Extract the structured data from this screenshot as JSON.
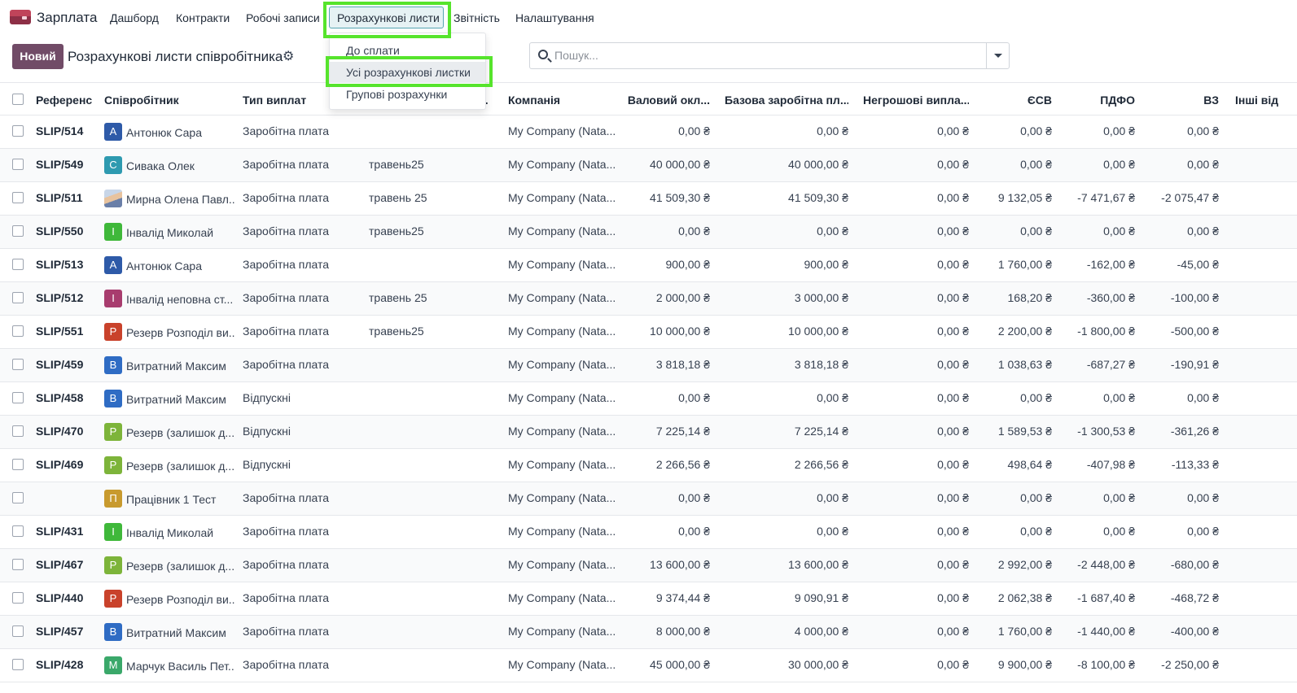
{
  "app": {
    "name": "Зарплата"
  },
  "nav": {
    "items": [
      "Дашборд",
      "Контракти",
      "Робочі записи",
      "Розрахункові листи",
      "Звітність",
      "Налаштування"
    ]
  },
  "dropdown": {
    "items": [
      "До сплати",
      "Усі розрахункові листки",
      "Групові розрахунки"
    ],
    "active_index": 1
  },
  "control_panel": {
    "new_button": "Новий",
    "title": "Розрахункові листи співробітника",
    "search_placeholder": "Пошук..."
  },
  "columns": [
    "Референс",
    "Співробітник",
    "Тип виплат",
    "...",
    "Компанія",
    "Валовий окл...",
    "Базова заробітна пл...",
    "Негрошові випла...",
    "ЄСВ",
    "ПДФО",
    "ВЗ",
    "Інші від"
  ],
  "rows": [
    {
      "ref": "SLIP/514",
      "initial": "А",
      "color": "#2e5aa8",
      "employee": "Антонюк Сара",
      "type": "Заробітна плата",
      "batch": "",
      "company": "My Company (Nata...",
      "gross": "0,00 ₴",
      "basic": "0,00 ₴",
      "noncash": "0,00 ₴",
      "esv": "0,00 ₴",
      "pdfo": "0,00 ₴",
      "vz": "0,00 ₴"
    },
    {
      "ref": "SLIP/549",
      "initial": "С",
      "color": "#2e9ab0",
      "employee": "Сивака Олек",
      "type": "Заробітна плата",
      "batch": "травень25",
      "company": "My Company (Nata...",
      "gross": "40 000,00 ₴",
      "basic": "40 000,00 ₴",
      "noncash": "0,00 ₴",
      "esv": "0,00 ₴",
      "pdfo": "0,00 ₴",
      "vz": "0,00 ₴"
    },
    {
      "ref": "SLIP/511",
      "initial": "",
      "color": "photo",
      "employee": "Мирна Олена Павл...",
      "type": "Заробітна плата",
      "batch": "травень 25",
      "company": "My Company (Nata...",
      "gross": "41 509,30 ₴",
      "basic": "41 509,30 ₴",
      "noncash": "0,00 ₴",
      "esv": "9 132,05 ₴",
      "pdfo": "-7 471,67 ₴",
      "vz": "-2 075,47 ₴"
    },
    {
      "ref": "SLIP/550",
      "initial": "І",
      "color": "#3fb83a",
      "employee": "Інвалід Миколай",
      "type": "Заробітна плата",
      "batch": "травень25",
      "company": "My Company (Nata...",
      "gross": "0,00 ₴",
      "basic": "0,00 ₴",
      "noncash": "0,00 ₴",
      "esv": "0,00 ₴",
      "pdfo": "0,00 ₴",
      "vz": "0,00 ₴"
    },
    {
      "ref": "SLIP/513",
      "initial": "А",
      "color": "#2e5aa8",
      "employee": "Антонюк Сара",
      "type": "Заробітна плата",
      "batch": "",
      "company": "My Company (Nata...",
      "gross": "900,00 ₴",
      "basic": "900,00 ₴",
      "noncash": "0,00 ₴",
      "esv": "1 760,00 ₴",
      "pdfo": "-162,00 ₴",
      "vz": "-45,00 ₴"
    },
    {
      "ref": "SLIP/512",
      "initial": "І",
      "color": "#a83c6e",
      "employee": "Інвалід неповна ст...",
      "type": "Заробітна плата",
      "batch": "травень 25",
      "company": "My Company (Nata...",
      "gross": "2 000,00 ₴",
      "basic": "3 000,00 ₴",
      "noncash": "0,00 ₴",
      "esv": "168,20 ₴",
      "pdfo": "-360,00 ₴",
      "vz": "-100,00 ₴"
    },
    {
      "ref": "SLIP/551",
      "initial": "Р",
      "color": "#c9422b",
      "employee": "Резерв Розподіл ви...",
      "type": "Заробітна плата",
      "batch": "травень25",
      "company": "My Company (Nata...",
      "gross": "10 000,00 ₴",
      "basic": "10 000,00 ₴",
      "noncash": "0,00 ₴",
      "esv": "2 200,00 ₴",
      "pdfo": "-1 800,00 ₴",
      "vz": "-500,00 ₴"
    },
    {
      "ref": "SLIP/459",
      "initial": "В",
      "color": "#2f6cc4",
      "employee": "Витратний Максим",
      "type": "Заробітна плата",
      "batch": "",
      "company": "My Company (Nata...",
      "gross": "3 818,18 ₴",
      "basic": "3 818,18 ₴",
      "noncash": "0,00 ₴",
      "esv": "1 038,63 ₴",
      "pdfo": "-687,27 ₴",
      "vz": "-190,91 ₴"
    },
    {
      "ref": "SLIP/458",
      "initial": "В",
      "color": "#2f6cc4",
      "employee": "Витратний Максим",
      "type": "Відпускні",
      "batch": "",
      "company": "My Company (Nata...",
      "gross": "0,00 ₴",
      "basic": "0,00 ₴",
      "noncash": "0,00 ₴",
      "esv": "0,00 ₴",
      "pdfo": "0,00 ₴",
      "vz": "0,00 ₴"
    },
    {
      "ref": "SLIP/470",
      "initial": "Р",
      "color": "#7db43a",
      "employee": "Резерв (залишок д...",
      "type": "Відпускні",
      "batch": "",
      "company": "My Company (Nata...",
      "gross": "7 225,14 ₴",
      "basic": "7 225,14 ₴",
      "noncash": "0,00 ₴",
      "esv": "1 589,53 ₴",
      "pdfo": "-1 300,53 ₴",
      "vz": "-361,26 ₴"
    },
    {
      "ref": "SLIP/469",
      "initial": "Р",
      "color": "#7db43a",
      "employee": "Резерв (залишок д...",
      "type": "Відпускні",
      "batch": "",
      "company": "My Company (Nata...",
      "gross": "2 266,56 ₴",
      "basic": "2 266,56 ₴",
      "noncash": "0,00 ₴",
      "esv": "498,64 ₴",
      "pdfo": "-407,98 ₴",
      "vz": "-113,33 ₴"
    },
    {
      "ref": "",
      "initial": "П",
      "color": "#c89a2e",
      "employee": "Працівник 1 Тест",
      "type": "Заробітна плата",
      "batch": "",
      "company": "My Company (Nata...",
      "gross": "0,00 ₴",
      "basic": "0,00 ₴",
      "noncash": "0,00 ₴",
      "esv": "0,00 ₴",
      "pdfo": "0,00 ₴",
      "vz": "0,00 ₴"
    },
    {
      "ref": "SLIP/431",
      "initial": "І",
      "color": "#3fb83a",
      "employee": "Інвалід Миколай",
      "type": "Заробітна плата",
      "batch": "",
      "company": "My Company (Nata...",
      "gross": "0,00 ₴",
      "basic": "0,00 ₴",
      "noncash": "0,00 ₴",
      "esv": "0,00 ₴",
      "pdfo": "0,00 ₴",
      "vz": "0,00 ₴"
    },
    {
      "ref": "SLIP/467",
      "initial": "Р",
      "color": "#7db43a",
      "employee": "Резерв (залишок д...",
      "type": "Заробітна плата",
      "batch": "",
      "company": "My Company (Nata...",
      "gross": "13 600,00 ₴",
      "basic": "13 600,00 ₴",
      "noncash": "0,00 ₴",
      "esv": "2 992,00 ₴",
      "pdfo": "-2 448,00 ₴",
      "vz": "-680,00 ₴"
    },
    {
      "ref": "SLIP/440",
      "initial": "Р",
      "color": "#c9422b",
      "employee": "Резерв Розподіл ви...",
      "type": "Заробітна плата",
      "batch": "",
      "company": "My Company (Nata...",
      "gross": "9 374,44 ₴",
      "basic": "9 090,91 ₴",
      "noncash": "0,00 ₴",
      "esv": "2 062,38 ₴",
      "pdfo": "-1 687,40 ₴",
      "vz": "-468,72 ₴"
    },
    {
      "ref": "SLIP/457",
      "initial": "В",
      "color": "#2f6cc4",
      "employee": "Витратний Максим",
      "type": "Заробітна плата",
      "batch": "",
      "company": "My Company (Nata...",
      "gross": "8 000,00 ₴",
      "basic": "4 000,00 ₴",
      "noncash": "0,00 ₴",
      "esv": "1 760,00 ₴",
      "pdfo": "-1 440,00 ₴",
      "vz": "-400,00 ₴"
    },
    {
      "ref": "SLIP/428",
      "initial": "М",
      "color": "#3aa86a",
      "employee": "Марчук Василь Пет...",
      "type": "Заробітна плата",
      "batch": "",
      "company": "My Company (Nata...",
      "gross": "45 000,00 ₴",
      "basic": "30 000,00 ₴",
      "noncash": "0,00 ₴",
      "esv": "9 900,00 ₴",
      "pdfo": "-8 100,00 ₴",
      "vz": "-2 250,00 ₴"
    }
  ],
  "colors": {
    "brand": "#714b67",
    "highlight": "#56e42c",
    "active_menu_border": "#55a5b2"
  }
}
